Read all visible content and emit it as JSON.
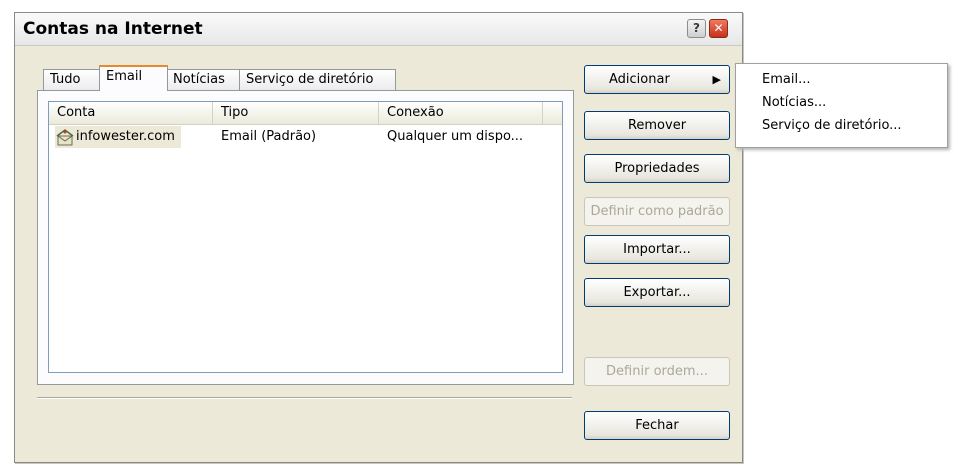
{
  "window": {
    "title": "Contas na Internet",
    "help_glyph": "?",
    "close_glyph": "✕"
  },
  "tabs": [
    {
      "label": "Tudo"
    },
    {
      "label": "Email",
      "active": true
    },
    {
      "label": "Notícias"
    },
    {
      "label": "Serviço de diretório"
    }
  ],
  "list": {
    "columns": [
      "Conta",
      "Tipo",
      "Conexão"
    ],
    "rows": [
      {
        "conta": "infowester.com",
        "tipo": "Email (Padrão)",
        "conexao": "Qualquer um dispo...",
        "icon": "mail-account-icon"
      }
    ]
  },
  "buttons": {
    "adicionar": "Adicionar",
    "remover": "Remover",
    "propriedades": "Propriedades",
    "definir_padrao": "Definir como padrão",
    "importar": "Importar...",
    "exportar": "Exportar...",
    "definir_ordem": "Definir ordem...",
    "fechar": "Fechar"
  },
  "add_menu": {
    "arrow_glyph": "▶",
    "items": [
      "Email...",
      "Notícias...",
      "Serviço de diretório..."
    ]
  },
  "colors": {
    "dialog_bg": "#ece9d8",
    "active_tab_accent": "#e68b2c",
    "button_border": "#003c74"
  }
}
